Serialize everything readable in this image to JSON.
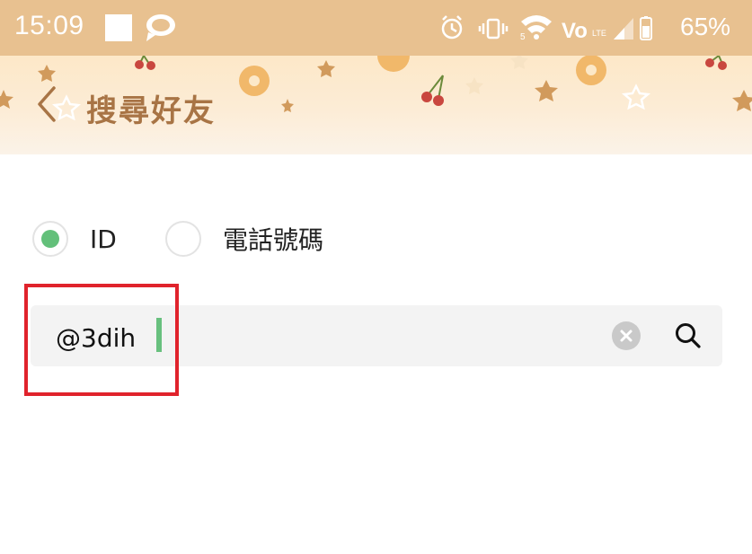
{
  "status_bar": {
    "time": "15:09",
    "battery_percent": "65%",
    "icons": [
      "square-notification-icon",
      "chat-bubble-icon",
      "alarm-icon",
      "vibrate-icon",
      "wifi-icon",
      "volte-icon",
      "signal-icon",
      "battery-icon"
    ],
    "background": "#e8c190"
  },
  "header": {
    "title": "搜尋好友",
    "back_icon": "chevron-left-icon",
    "title_color": "#a87445"
  },
  "search_type": {
    "options": [
      {
        "label": "ID",
        "selected": true
      },
      {
        "label": "電話號碼",
        "selected": false
      }
    ],
    "selected_color": "#63c07a"
  },
  "search": {
    "value": "@3dih",
    "clear_icon": "clear-circle-icon",
    "search_icon": "search-icon"
  },
  "annotation": {
    "highlight_color": "#e0232c"
  }
}
